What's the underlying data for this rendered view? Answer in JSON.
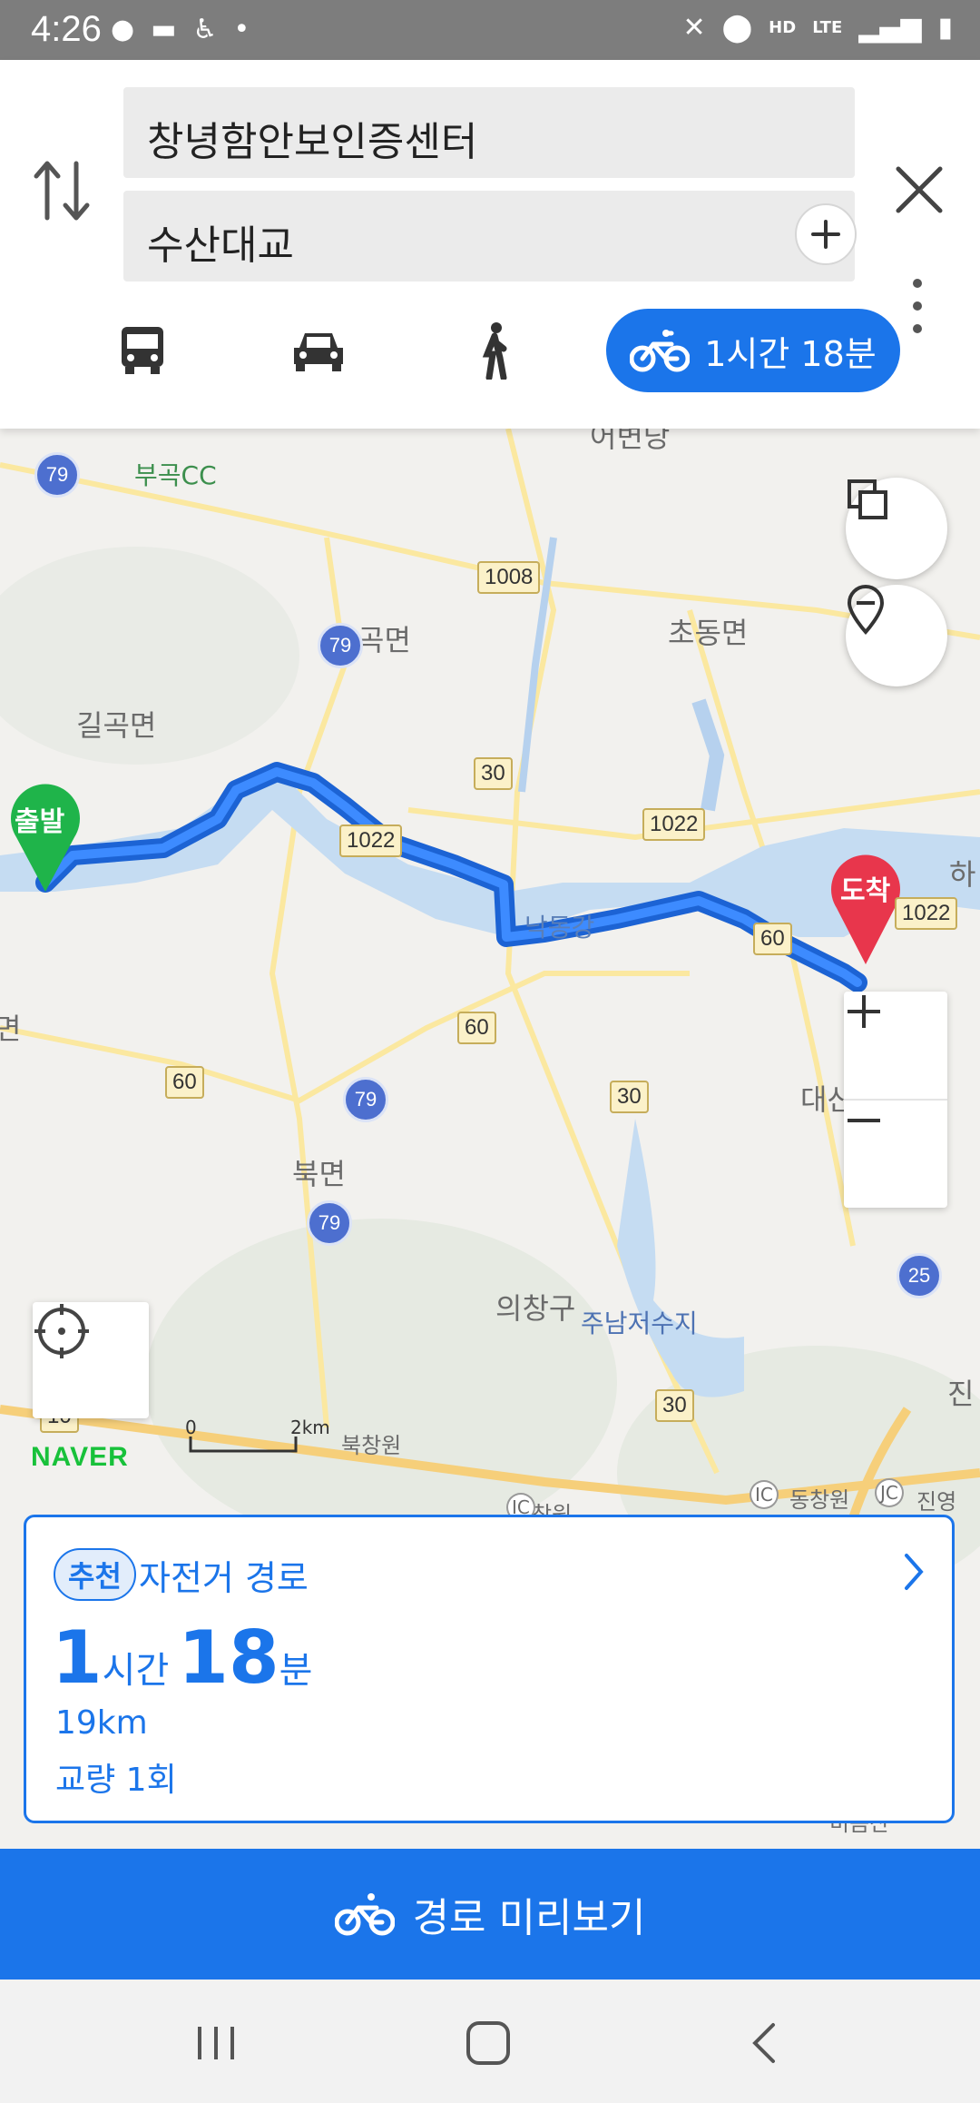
{
  "status_bar": {
    "time": "4:26",
    "left_icons": [
      "talk-icon",
      "message-icon",
      "accessibility-icon",
      "dot-icon"
    ],
    "right_icons": [
      "mute-icon",
      "location-icon",
      "hd-voice-icon",
      "lte-icon",
      "signal-icon",
      "battery-icon"
    ],
    "hd_text": "HD",
    "lte_text": "LTE"
  },
  "search": {
    "origin": "창녕함안보인증센터",
    "destination": "수산대교"
  },
  "modes": {
    "bike_duration": "1시간 18분",
    "items": [
      "bus-icon",
      "car-icon",
      "walk-icon",
      "bike-icon"
    ],
    "selected": "bike"
  },
  "map": {
    "labels": [
      "어변당",
      "부곡CC",
      "곡면",
      "초동면",
      "길곡면",
      "낙동강",
      "북면",
      "의창구",
      "주남저수지",
      "대산",
      "진영",
      "동창원",
      "북창원",
      "하",
      "면",
      "진",
      "창원",
      "비음산"
    ],
    "road_badges": [
      "1008",
      "30",
      "1022",
      "1022",
      "60",
      "1022",
      "60",
      "60",
      "30",
      "30",
      "10"
    ],
    "route_badges": [
      "79",
      "79",
      "79",
      "79",
      "25"
    ],
    "start_marker": "출발",
    "end_marker": "도착",
    "scale_zero": "0",
    "scale_label": "2km",
    "logo": "NAVER",
    "ic_labels": [
      "IC",
      "IC",
      "JC"
    ]
  },
  "route_card": {
    "badge": "추천",
    "type": "자전거 경로",
    "hours": "1",
    "hours_unit": "시간",
    "minutes": "18",
    "minutes_unit": "분",
    "distance": "19km",
    "bridges": "교량 1회"
  },
  "preview_button": {
    "label": "경로 미리보기"
  },
  "colors": {
    "accent": "#1b75ea",
    "start_green": "#1fb44a",
    "end_red": "#e8364c",
    "river": "#c5dcf2"
  }
}
